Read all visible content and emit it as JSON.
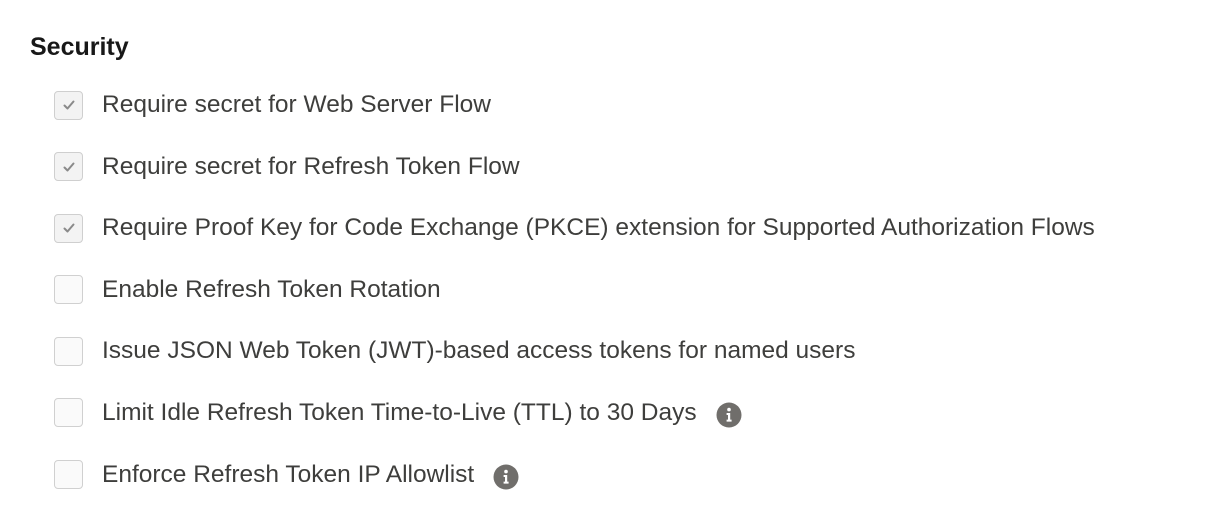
{
  "section": {
    "title": "Security"
  },
  "options": [
    {
      "label": "Require secret for Web Server Flow",
      "checked": true,
      "has_info": false
    },
    {
      "label": "Require secret for Refresh Token Flow",
      "checked": true,
      "has_info": false
    },
    {
      "label": "Require Proof Key for Code Exchange (PKCE) extension for Supported Authorization Flows",
      "checked": true,
      "has_info": false
    },
    {
      "label": "Enable Refresh Token Rotation",
      "checked": false,
      "has_info": false
    },
    {
      "label": "Issue JSON Web Token (JWT)-based access tokens for named users",
      "checked": false,
      "has_info": false
    },
    {
      "label": "Limit Idle Refresh Token Time-to-Live (TTL) to 30 Days",
      "checked": false,
      "has_info": true
    },
    {
      "label": "Enforce Refresh Token IP Allowlist",
      "checked": false,
      "has_info": true
    }
  ],
  "icons": {
    "check": "check-icon",
    "info": "info-icon"
  },
  "colors": {
    "checkmark": "#8a8a8a",
    "info_icon": "#706e6b",
    "label_text": "#3e3e3c",
    "title_text": "#181818"
  }
}
